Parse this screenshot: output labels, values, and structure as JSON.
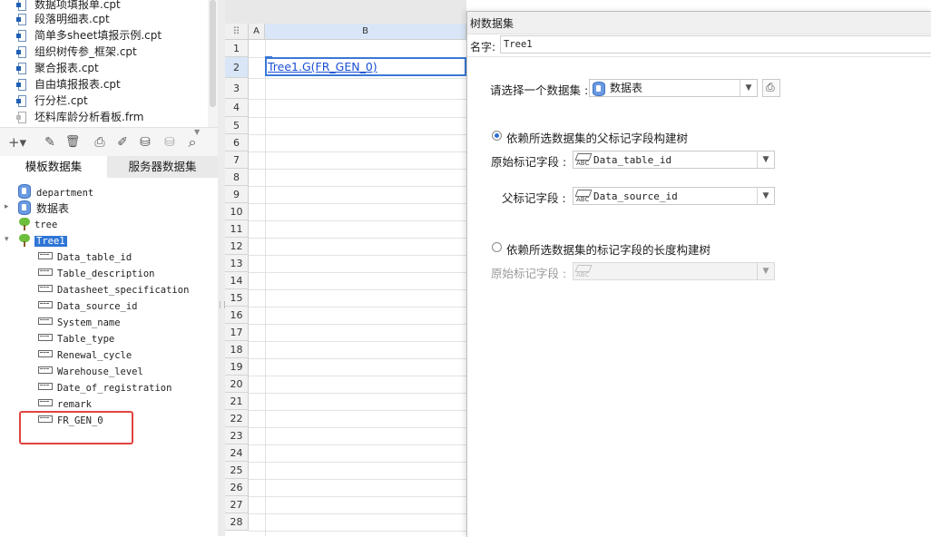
{
  "file_list": {
    "items": [
      {
        "label": "数据项填报单.cpt",
        "type": "cpt"
      },
      {
        "label": "段落明细表.cpt",
        "type": "cpt"
      },
      {
        "label": "简单多sheet填报示例.cpt",
        "type": "cpt"
      },
      {
        "label": "组织树传参_框架.cpt",
        "type": "cpt"
      },
      {
        "label": "聚合报表.cpt",
        "type": "cpt"
      },
      {
        "label": "自由填报报表.cpt",
        "type": "cpt"
      },
      {
        "label": "行分栏.cpt",
        "type": "cpt"
      },
      {
        "label": "坯料库龄分析看板.frm",
        "type": "frm"
      }
    ]
  },
  "toolbar": {
    "icons": [
      "add-icon",
      "edit-icon",
      "delete-icon",
      "preview-icon",
      "edit-dataset-icon",
      "database-icon",
      "server-dataset-icon",
      "search-icon"
    ],
    "add_glyph": "+▾",
    "edit_glyph": "✎",
    "delete_glyph": "🗑",
    "preview_glyph": "⎙",
    "editds_glyph": "✐",
    "db_glyph": "⛁",
    "serverdb_glyph": "⛁",
    "search_glyph": "⌕"
  },
  "dataset_tabs": {
    "template": "模板数据集",
    "server": "服务器数据集"
  },
  "dataset_tree": {
    "datasets": [
      {
        "label": "department",
        "icon": "database-icon"
      },
      {
        "label": "数据表",
        "icon": "database-icon"
      },
      {
        "label": "tree",
        "icon": "tree-icon"
      },
      {
        "label": "Tree1",
        "icon": "tree-icon",
        "selected": true
      }
    ],
    "fields": [
      "Data_table_id",
      "Table_description",
      "Datasheet_specification",
      "Data_source_id",
      "System_name",
      "Table_type",
      "Renewal_cycle",
      "Warehouse_level",
      "Date_of_registration",
      "remark",
      "FR_GEN_0"
    ],
    "expanded_glyph": "▾",
    "collapsed_glyph": "▸"
  },
  "sheet": {
    "columns": [
      "A",
      "B"
    ],
    "rows": [
      "1",
      "2",
      "3",
      "4",
      "5",
      "6",
      "7",
      "8",
      "9",
      "10",
      "11",
      "12",
      "13",
      "14",
      "15",
      "16",
      "17",
      "18",
      "19",
      "20",
      "21",
      "22",
      "23",
      "24",
      "25",
      "26",
      "27",
      "28"
    ],
    "cell_b2": "Tree1.G(FR_GEN_0)"
  },
  "dialog": {
    "title": "树数据集",
    "name_label": "名字:",
    "name_value": "Tree1",
    "select_dataset_label": "请选择一个数据集 :",
    "selected_dataset": "数据表",
    "option_parent": {
      "label": "依赖所选数据集的父标记字段构建树",
      "checked": true,
      "original_field_label": "原始标记字段 :",
      "original_field_value": "Data_table_id",
      "parent_field_label": "父标记字段 :",
      "parent_field_value": "Data_source_id"
    },
    "option_length": {
      "label": "依赖所选数据集的标记字段的长度构建树",
      "checked": false,
      "original_field_label": "原始标记字段 :",
      "original_field_value": ""
    },
    "abc_text": "ABC",
    "dropdown_glyph": "▼"
  },
  "colors": {
    "selection": "#2f75d6",
    "cell_link": "#1a4fd6",
    "highlight_box": "#e0443e",
    "tree_green": "#6cbf3c",
    "db_blue": "#6a9ae0"
  }
}
